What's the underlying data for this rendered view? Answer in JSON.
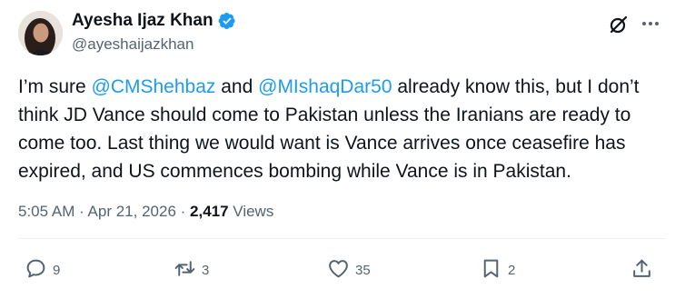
{
  "author": {
    "display_name": "Ayesha Ijaz Khan",
    "handle": "@ayeshaijazkhan",
    "verified": true,
    "verified_color": "#1d9bf0"
  },
  "tweet": {
    "text_parts": {
      "p1": "I’m sure ",
      "m1": "@CMShehbaz",
      "p2": " and ",
      "m2": "@MIshaqDar50",
      "p3": " already know this, but I don’t think JD Vance should come to Pakistan unless the Iranians are ready to come too. Last thing we would want is Vance arrives once ceasefire has expired, and US commences bombing while Vance is in Pakistan."
    },
    "mention_color": "#1d9bf0",
    "time": "5:05 AM",
    "separator": " · ",
    "date": "Apr 21, 2026",
    "views_count": "2,417",
    "views_label": "Views"
  },
  "actions": {
    "reply_count": "9",
    "retweet_count": "3",
    "like_count": "35",
    "bookmark_count": "2"
  },
  "icons": [
    "grok-icon",
    "more-icon",
    "reply-icon",
    "retweet-icon",
    "like-icon",
    "bookmark-icon",
    "share-icon",
    "verified-badge-icon"
  ]
}
